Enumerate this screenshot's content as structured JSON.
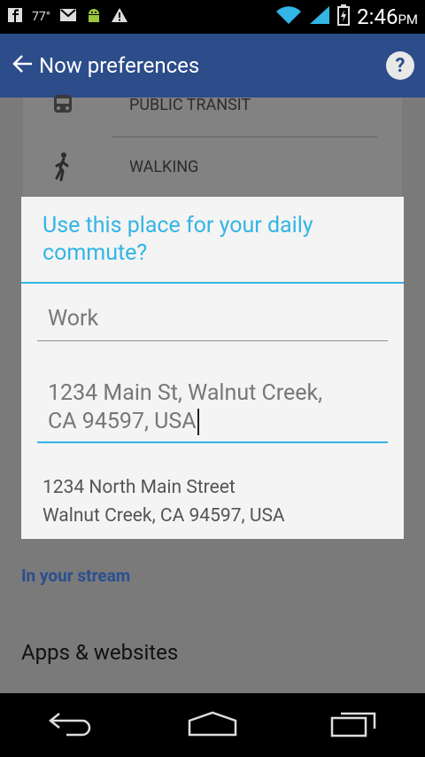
{
  "status_bar": {
    "temperature": "77°",
    "time": "2:46",
    "ampm": "PM"
  },
  "action_bar": {
    "title": "Now preferences"
  },
  "background": {
    "travel_modes": [
      "PUBLIC TRANSIT",
      "WALKING"
    ],
    "section_header": "In your stream",
    "apps_label": "Apps & websites"
  },
  "dialog": {
    "title": "Use this place for your daily commute?",
    "name_value": "Work",
    "address_line1": "1234 Main St, Walnut Creek,",
    "address_line2": "CA 94597, USA",
    "suggestion_line1": "1234 North Main Street",
    "suggestion_line2": "Walnut Creek, CA 94597, USA"
  },
  "colors": {
    "accent": "#33b5e5",
    "action_bar": "#2c4c8a",
    "section_header": "#2b4f8f"
  }
}
